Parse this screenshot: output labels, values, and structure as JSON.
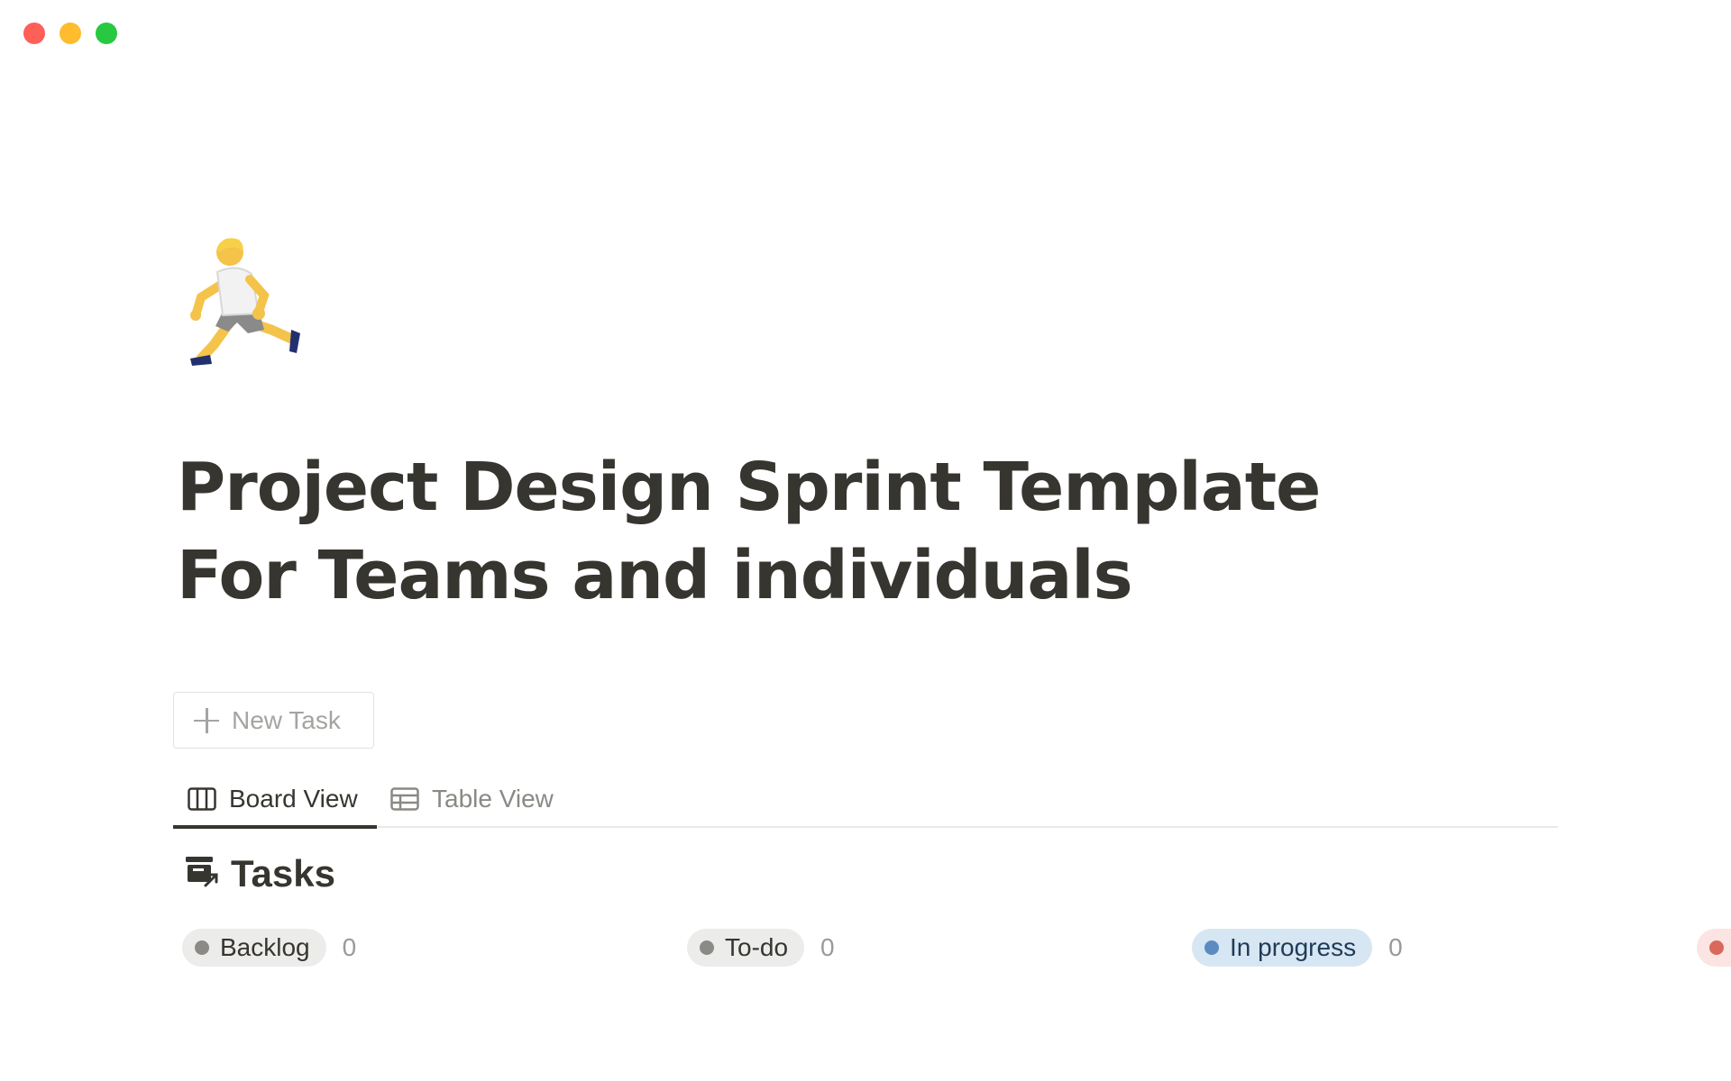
{
  "window": {
    "controls": [
      "close",
      "minimize",
      "maximize"
    ]
  },
  "page": {
    "icon": "person-running-icon",
    "title": "Project Design Sprint Template For Teams and individuals"
  },
  "new_task_button": {
    "label": "New Task",
    "icon": "plus-icon"
  },
  "tabs": [
    {
      "label": "Board View",
      "icon": "board-columns-icon",
      "active": true
    },
    {
      "label": "Table View",
      "icon": "table-grid-icon",
      "active": false
    }
  ],
  "database": {
    "title": "Tasks",
    "icon": "tasks-database-icon"
  },
  "columns": [
    {
      "label": "Backlog",
      "count": "0",
      "color": "#8b8a86"
    },
    {
      "label": "To-do",
      "count": "0",
      "color": "#8b8a86"
    },
    {
      "label": "In progress",
      "count": "0",
      "color": "#5b8bc0"
    },
    {
      "label": "",
      "count": "",
      "color": "#d9685d"
    }
  ],
  "colors": {
    "text": "#37352f",
    "muted": "#8a8984",
    "border": "#e9e9e7"
  }
}
